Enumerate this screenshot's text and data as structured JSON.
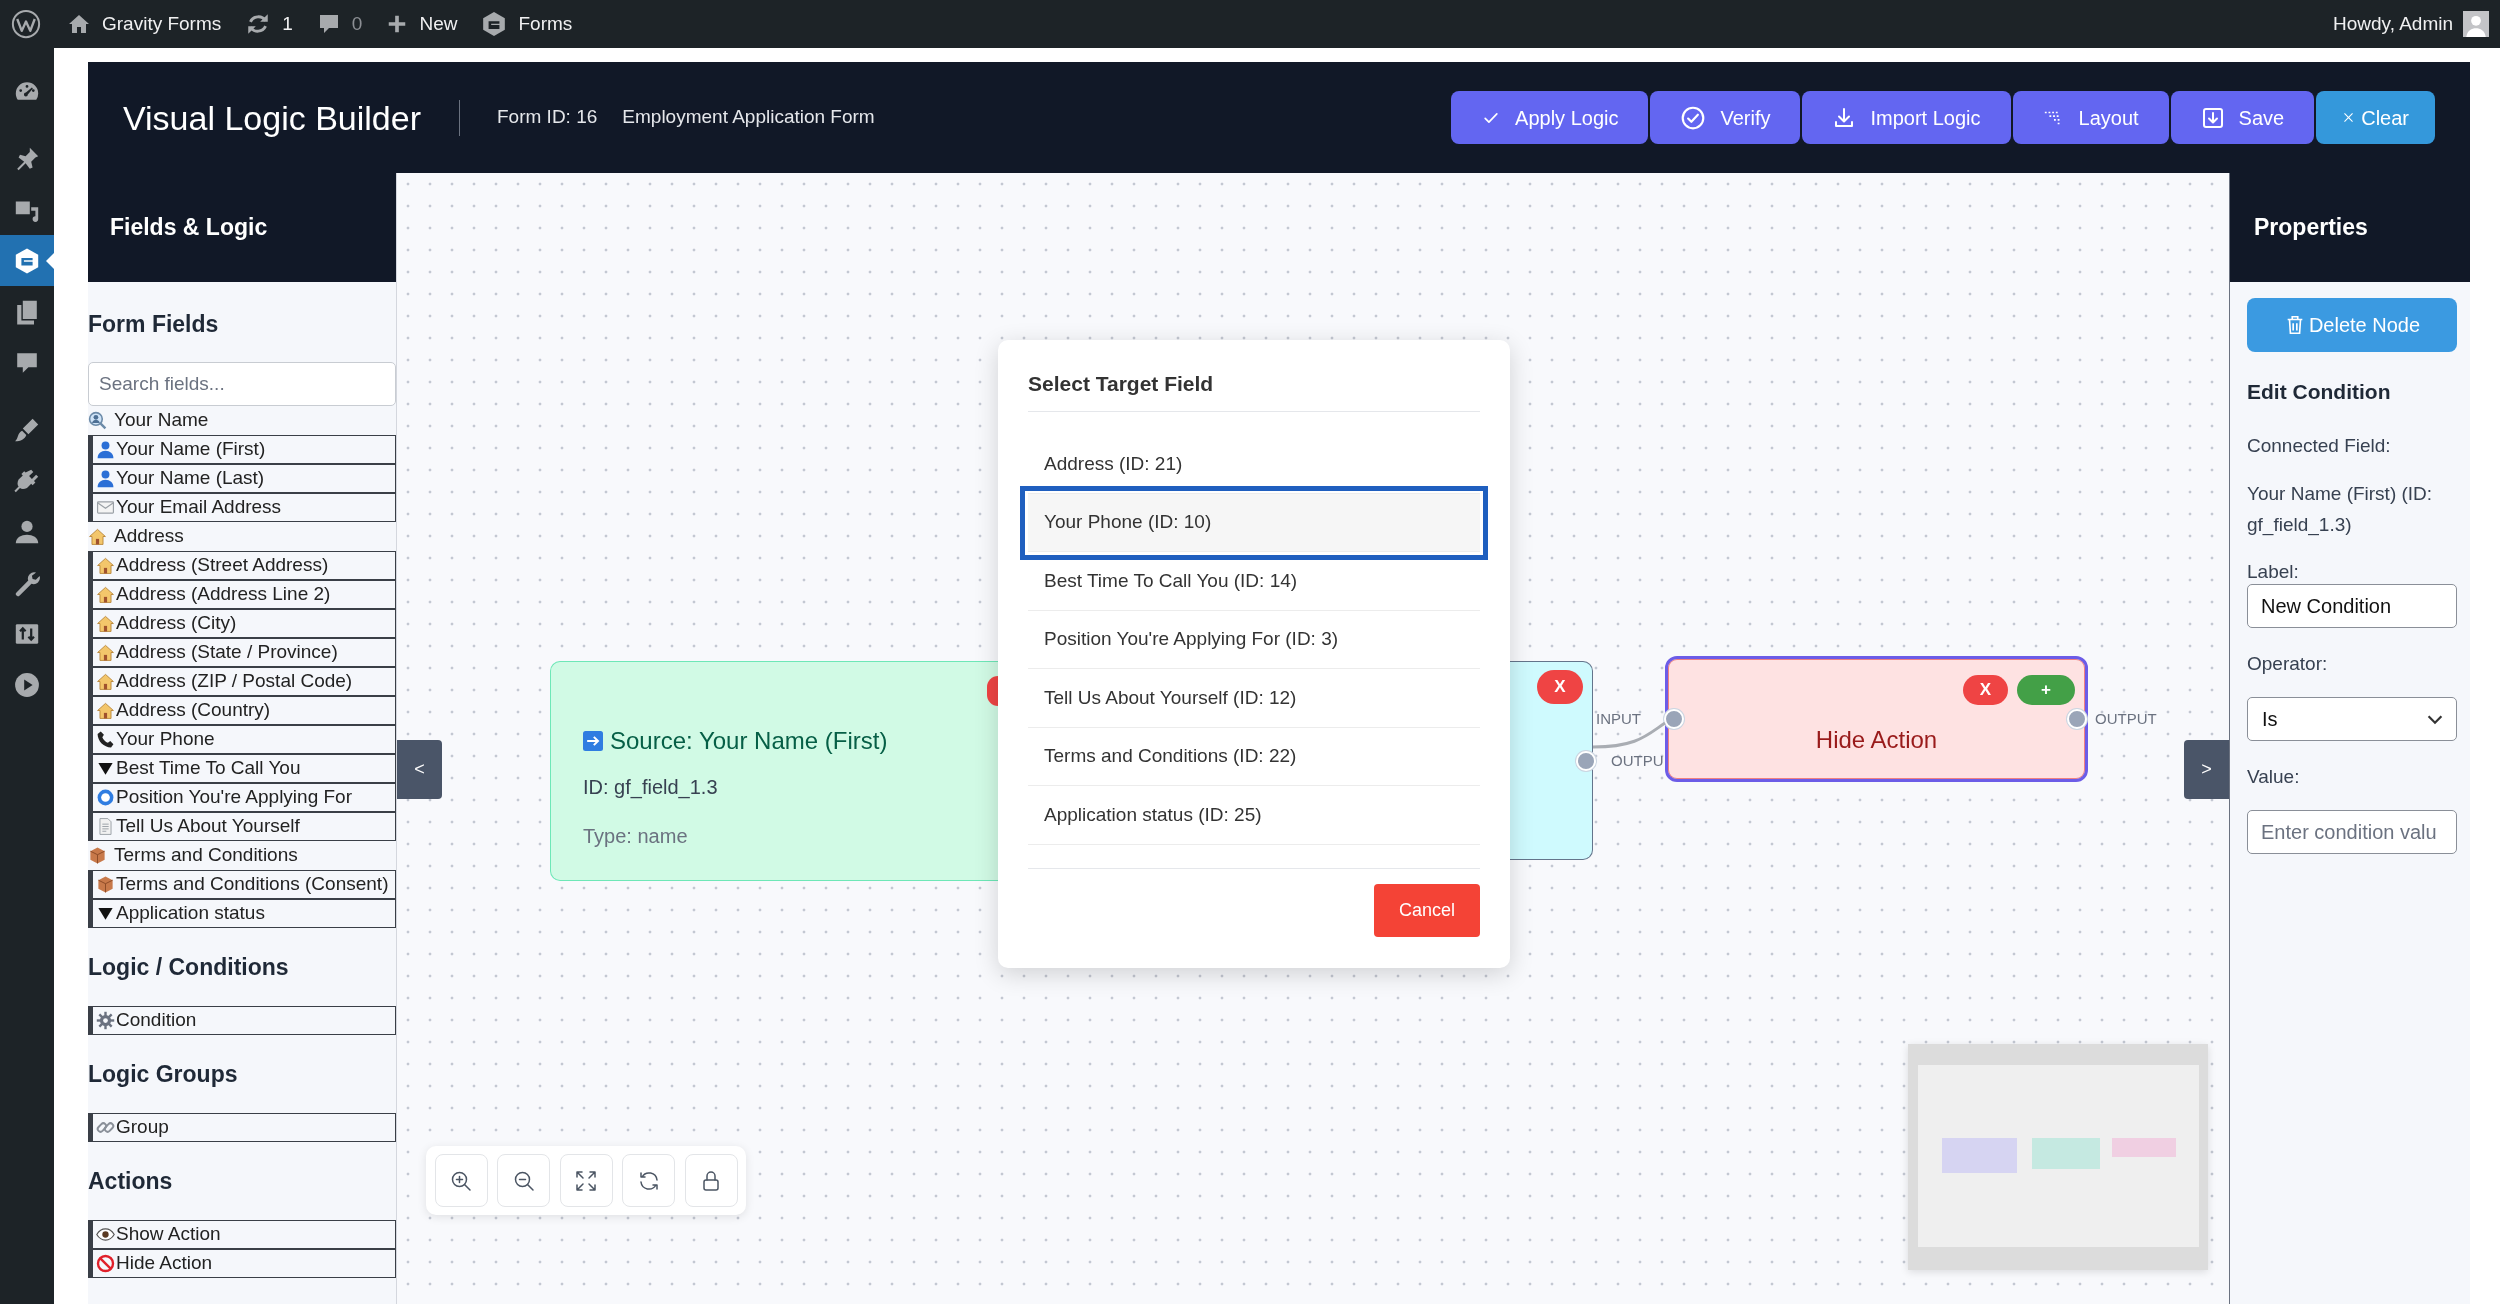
{
  "admin_bar": {
    "site": "Gravity Forms",
    "updates": "1",
    "comments": "0",
    "new": "New",
    "forms": "Forms",
    "greeting": "Howdy, Admin"
  },
  "admin_menu": [
    {
      "selected": false
    },
    {
      "selected": false
    },
    {
      "selected": false
    },
    {
      "selected": true
    },
    {
      "selected": false
    },
    {
      "selected": false
    },
    {
      "selected": false
    },
    {
      "selected": false
    },
    {
      "selected": false
    },
    {
      "selected": false
    },
    {
      "selected": false
    },
    {
      "selected": false
    }
  ],
  "header": {
    "title": "Visual Logic Builder",
    "form_id": "Form ID: 16",
    "form_name": "Employment Application Form",
    "buttons": [
      {
        "label": "Apply Logic",
        "kind": "primary"
      },
      {
        "label": "Verify",
        "kind": "primary"
      },
      {
        "label": "Import Logic",
        "kind": "primary"
      },
      {
        "label": "Layout",
        "kind": "primary"
      },
      {
        "label": "Save",
        "kind": "primary"
      },
      {
        "label": "Clear",
        "kind": "secondary"
      }
    ]
  },
  "sidebar": {
    "title": "Fields & Logic",
    "sections": [
      {
        "heading": "Form Fields",
        "search": {
          "placeholder": "Search fields..."
        },
        "items": [
          {
            "label": "Your Name",
            "kind": "name",
            "children": [
              {
                "label": "Your Name (First)",
                "kind": "name"
              },
              {
                "label": "Your Name (Last)",
                "kind": "name"
              }
            ]
          },
          {
            "label": "Your Email Address",
            "kind": "email"
          },
          {
            "label": "Address",
            "kind": "address",
            "children": [
              {
                "label": "Address (Street Address)",
                "kind": "address"
              },
              {
                "label": "Address (Address Line 2)",
                "kind": "address"
              },
              {
                "label": "Address (City)",
                "kind": "address"
              },
              {
                "label": "Address (State / Province)",
                "kind": "address"
              },
              {
                "label": "Address (ZIP / Postal Code)",
                "kind": "address"
              },
              {
                "label": "Address (Country)",
                "kind": "address"
              }
            ]
          },
          {
            "label": "Your Phone",
            "kind": "phone"
          },
          {
            "label": "Best Time To Call You",
            "kind": "select"
          },
          {
            "label": "Position You're Applying For",
            "kind": "radio"
          },
          {
            "label": "Tell Us About Yourself",
            "kind": "textarea"
          },
          {
            "label": "Terms and Conditions",
            "kind": "consent",
            "children": [
              {
                "label": "Terms and Conditions (Consent)",
                "kind": "consent"
              }
            ]
          },
          {
            "label": "Application status",
            "kind": "select"
          }
        ]
      },
      {
        "heading": "Logic / Conditions",
        "items": [
          {
            "label": "Condition",
            "kind": "condition"
          }
        ]
      },
      {
        "heading": "Logic Groups",
        "items": [
          {
            "label": "Group",
            "kind": "group"
          }
        ]
      },
      {
        "heading": "Actions",
        "items": [
          {
            "label": "Show Action",
            "kind": "show"
          },
          {
            "label": "Hide Action",
            "kind": "hide"
          }
        ]
      }
    ]
  },
  "canvas": {
    "left_toggle": "<",
    "right_toggle": ">",
    "nodes": [
      {
        "kind": "source",
        "title": "Source: Your Name (First)",
        "details": [
          "ID: gf_field_1.3",
          "Type: name"
        ],
        "buttons": [
          {
            "kind": "delete"
          }
        ],
        "selected": false
      },
      {
        "kind": "condition",
        "buttons": [
          {
            "kind": "delete",
            "label": "X"
          }
        ],
        "ports": [
          {
            "kind": "output",
            "label": "OUTPU"
          }
        ],
        "selected": false
      },
      {
        "kind": "action",
        "title": "Hide Action",
        "buttons": [
          {
            "kind": "delete",
            "label": "X"
          },
          {
            "kind": "add",
            "label": "+"
          }
        ],
        "ports": [
          {
            "kind": "input",
            "label": "INPUT"
          },
          {
            "kind": "output",
            "label": "OUTPUT"
          }
        ],
        "selected": true
      }
    ]
  },
  "dialog": {
    "title": "Select Target Field",
    "options": [
      {
        "label": "Address (ID: 21)",
        "selected": false
      },
      {
        "label": "Your Phone (ID: 10)",
        "selected": true
      },
      {
        "label": "Best Time To Call You (ID: 14)",
        "selected": false
      },
      {
        "label": "Position You're Applying For (ID: 3)",
        "selected": false
      },
      {
        "label": "Tell Us About Yourself (ID: 12)",
        "selected": false
      },
      {
        "label": "Terms and Conditions (ID: 22)",
        "selected": false
      },
      {
        "label": "Application status (ID: 25)",
        "selected": false
      }
    ],
    "cancel": "Cancel"
  },
  "properties": {
    "title": "Properties",
    "delete_button": "Delete Node",
    "heading": "Edit Condition",
    "connected_label": "Connected Field:",
    "connected_value": "Your Name (First) (ID: gf_field_1.3)",
    "fields": [
      {
        "kind": "text",
        "label": "Label:",
        "value": "New Condition"
      },
      {
        "kind": "select",
        "label": "Operator:",
        "value": "Is"
      },
      {
        "kind": "text",
        "label": "Value:",
        "placeholder": "Enter condition valu"
      }
    ]
  }
}
